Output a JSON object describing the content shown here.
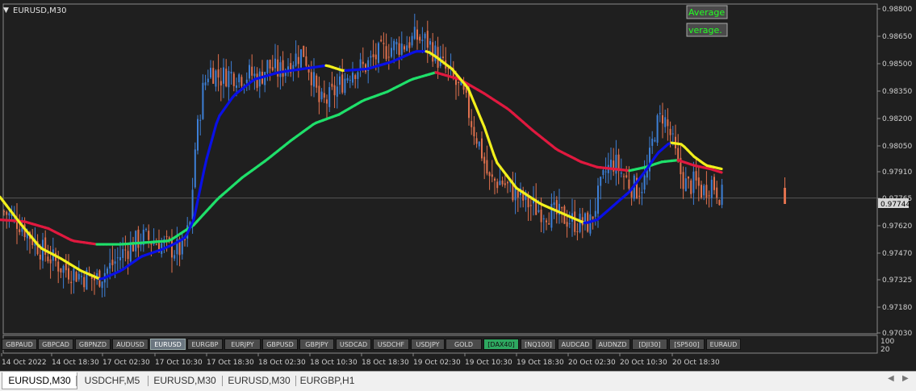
{
  "window": {
    "title": "EURUSD,M30",
    "menu_icon": "triangle-down-icon"
  },
  "indicator_buttons": [
    "Average",
    "verage."
  ],
  "price_axis": {
    "labels": [
      "0.98800",
      "0.98650",
      "0.98500",
      "0.98350",
      "0.98200",
      "0.98050",
      "0.97910",
      "0.97765",
      "0.97620",
      "0.97470",
      "0.97325",
      "0.97180",
      "0.97030"
    ],
    "current_price": "0.97744"
  },
  "sub_axis": [
    "100",
    "20"
  ],
  "time_axis": [
    "14 Oct 2022",
    "14 Oct 18:30",
    "17 Oct 02:30",
    "17 Oct 10:30",
    "17 Oct 18:30",
    "18 Oct 02:30",
    "18 Oct 10:30",
    "18 Oct 18:30",
    "19 Oct 02:30",
    "19 Oct 10:30",
    "19 Oct 18:30",
    "20 Oct 02:30",
    "20 Oct 10:30",
    "20 Oct 18:30"
  ],
  "symbols": [
    {
      "label": "GBPAUD"
    },
    {
      "label": "GBPCAD"
    },
    {
      "label": "GBPNZD"
    },
    {
      "label": "AUDUSD"
    },
    {
      "label": "EURUSD",
      "active": true
    },
    {
      "label": "EURGBP"
    },
    {
      "label": "EURJPY"
    },
    {
      "label": "GBPUSD"
    },
    {
      "label": "GBPJPY"
    },
    {
      "label": "USDCAD"
    },
    {
      "label": "USDCHF"
    },
    {
      "label": "USDJPY"
    },
    {
      "label": "GOLD"
    },
    {
      "label": "[DAX40]",
      "green": true
    },
    {
      "label": "[NQ100]"
    },
    {
      "label": "AUDCAD"
    },
    {
      "label": "AUDNZD"
    },
    {
      "label": "[DJI30]"
    },
    {
      "label": "[SP500]"
    },
    {
      "label": "EURAUD"
    }
  ],
  "tabs": [
    {
      "label": "EURUSD,M30",
      "active": true
    },
    {
      "label": "USDCHF,M5"
    },
    {
      "label": "EURUSD,M30"
    },
    {
      "label": "EURUSD,M30"
    },
    {
      "label": "EURGBP,H1"
    }
  ],
  "colors": {
    "background": "#1f1f1f",
    "up": "#3d7fd6",
    "down": "#e0714e",
    "ma_fast_up": "#0a10e6",
    "ma_fast_down": "#f2f01c",
    "ma_slow_up": "#1fe06a",
    "ma_slow_down": "#e0193f",
    "grid_line": "#4a4a4a",
    "text": "#d0d0d0",
    "indicator_text": "#22ff22"
  },
  "chart_data": {
    "type": "candlestick",
    "symbol": "EURUSD",
    "timeframe": "M30",
    "ylim": [
      0.9697,
      0.9885
    ],
    "current_price": 0.97744,
    "series": [
      {
        "role": "price",
        "x": [
          0,
          24,
          50,
          75,
          100,
          118,
          135,
          155,
          175,
          200,
          215,
          225,
          235,
          240,
          250,
          258,
          265,
          272,
          280,
          290,
          300,
          310,
          320,
          330,
          345,
          360,
          375,
          385,
          395,
          405,
          420,
          435,
          450,
          465,
          480,
          500,
          515,
          530,
          545,
          560,
          575,
          585,
          595,
          605,
          620,
          640,
          660,
          680,
          700,
          715,
          730,
          740,
          750,
          760,
          770,
          780,
          790,
          800,
          810,
          820,
          830,
          840,
          850,
          860,
          870,
          880,
          894
        ],
        "y": [
          0.9768,
          0.976,
          0.9745,
          0.9735,
          0.973,
          0.9728,
          0.9735,
          0.9745,
          0.9752,
          0.9748,
          0.9745,
          0.9745,
          0.976,
          0.98,
          0.9835,
          0.9848,
          0.9846,
          0.9843,
          0.9845,
          0.9845,
          0.9844,
          0.9845,
          0.9842,
          0.985,
          0.9846,
          0.9853,
          0.9858,
          0.9845,
          0.9828,
          0.983,
          0.9839,
          0.9848,
          0.9849,
          0.9855,
          0.986,
          0.9862,
          0.9866,
          0.9863,
          0.9851,
          0.9842,
          0.9831,
          0.9815,
          0.9802,
          0.9784,
          0.9784,
          0.9776,
          0.9769,
          0.9766,
          0.9763,
          0.976,
          0.976,
          0.9775,
          0.979,
          0.9795,
          0.9788,
          0.9782,
          0.9779,
          0.9786,
          0.9813,
          0.9822,
          0.981,
          0.9791,
          0.9781,
          0.9783,
          0.9778,
          0.9784,
          0.9775
        ]
      },
      {
        "role": "ma_fast",
        "name": "",
        "x": [
          0,
          25,
          50,
          75,
          100,
          125,
          150,
          175,
          200,
          215,
          230,
          240,
          255,
          270,
          290,
          315,
          345,
          375,
          405,
          425,
          455,
          485,
          515,
          530,
          540,
          560,
          580,
          600,
          615,
          640,
          670,
          700,
          725,
          740,
          760,
          780,
          800,
          815,
          830,
          845,
          860,
          875,
          894
        ],
        "y": [
          0.9775,
          0.976,
          0.9746,
          0.974,
          0.9733,
          0.9728,
          0.9733,
          0.9741,
          0.9745,
          0.9748,
          0.9752,
          0.9762,
          0.9795,
          0.982,
          0.9833,
          0.9842,
          0.9846,
          0.9848,
          0.985,
          0.9847,
          0.9848,
          0.9852,
          0.9858,
          0.9858,
          0.9855,
          0.9848,
          0.9837,
          0.9815,
          0.9795,
          0.978,
          0.9771,
          0.9765,
          0.976,
          0.9762,
          0.977,
          0.9778,
          0.979,
          0.98,
          0.9806,
          0.9805,
          0.9798,
          0.9793,
          0.9791
        ]
      },
      {
        "role": "ma_slow",
        "name": "",
        "x": [
          0,
          30,
          60,
          90,
          120,
          150,
          180,
          210,
          240,
          270,
          300,
          330,
          360,
          390,
          420,
          450,
          480,
          510,
          540,
          570,
          600,
          630,
          660,
          690,
          720,
          740,
          760,
          780,
          800,
          820,
          840,
          860,
          880,
          894
        ],
        "y": [
          0.9762,
          0.9761,
          0.9757,
          0.975,
          0.9748,
          0.9748,
          0.9749,
          0.975,
          0.9759,
          0.9774,
          0.9786,
          0.9796,
          0.9807,
          0.9817,
          0.9822,
          0.983,
          0.9835,
          0.9842,
          0.9846,
          0.9842,
          0.9834,
          0.9825,
          0.9813,
          0.9802,
          0.9795,
          0.9792,
          0.9791,
          0.979,
          0.9792,
          0.9795,
          0.9796,
          0.9793,
          0.9791,
          0.9789
        ]
      }
    ]
  }
}
